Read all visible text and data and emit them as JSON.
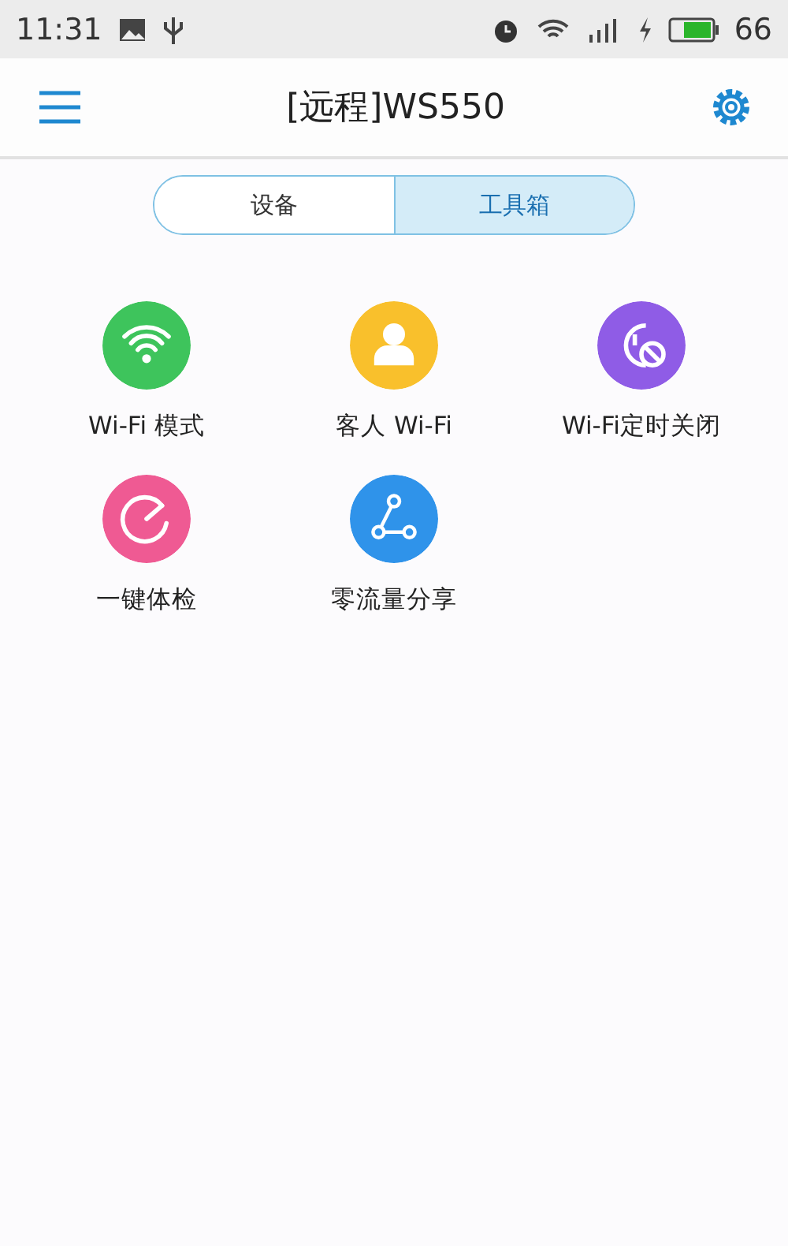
{
  "status_bar": {
    "time": "11:31",
    "battery": "66"
  },
  "header": {
    "title": "[远程]WS550"
  },
  "tabs": [
    {
      "label": "设备",
      "selected": false
    },
    {
      "label": "工具箱",
      "selected": true
    }
  ],
  "tools": [
    {
      "label": "Wi-Fi 模式",
      "kind": "wifi",
      "color": "#3ec45c"
    },
    {
      "label": "客人 Wi-Fi",
      "kind": "guest",
      "color": "#f9c02c"
    },
    {
      "label": "Wi-Fi定时关闭",
      "kind": "timer",
      "color": "#8f5ce6"
    },
    {
      "label": "一键体检",
      "kind": "checkup",
      "color": "#ef5a93"
    },
    {
      "label": "零流量分享",
      "kind": "share",
      "color": "#2f93ea"
    }
  ]
}
